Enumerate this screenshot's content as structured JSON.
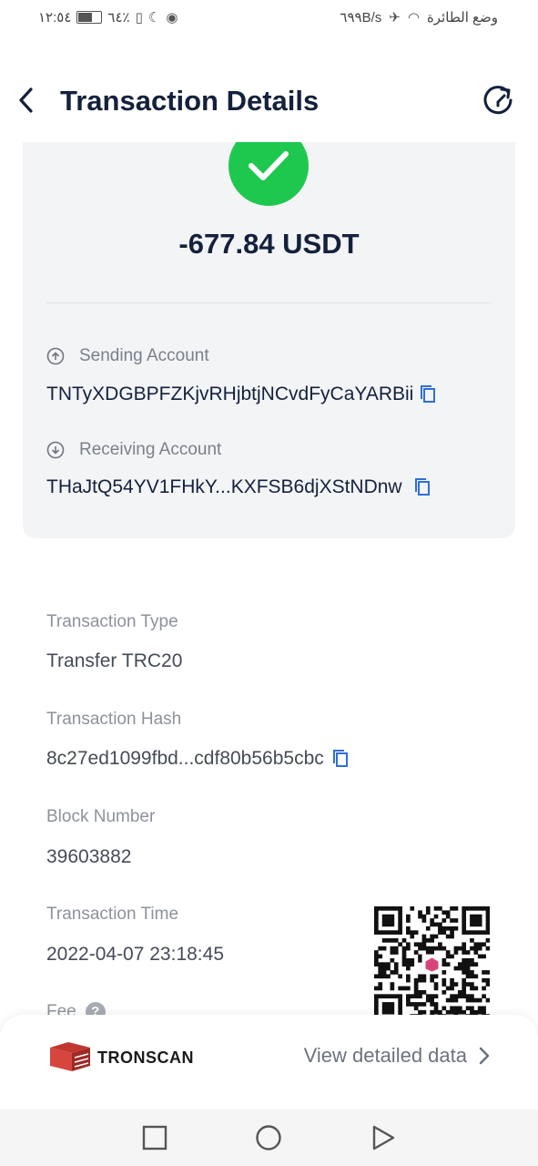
{
  "status_bar": {
    "time": "١٢:٥٤",
    "battery": "٦٤٪",
    "speed": "٦٩٩B/s",
    "airplane_mode": "وضع الطائرة"
  },
  "header": {
    "title": "Transaction Details"
  },
  "summary": {
    "amount": "-677.84 USDT",
    "sending_label": "Sending Account",
    "sending_address": "TNTyXDGBPFZKjvRHjbtjNCvdFyCaYARBii",
    "receiving_label": "Receiving Account",
    "receiving_address": "THaJtQ54YV1FHkY...KXFSB6djXStNDnw"
  },
  "details": {
    "type_label": "Transaction Type",
    "type_value": "Transfer TRC20",
    "hash_label": "Transaction Hash",
    "hash_value": "8c27ed1099fbd...cdf80b56b5cbc",
    "block_label": "Block Number",
    "block_value": "39603882",
    "time_label": "Transaction Time",
    "time_value": "2022-04-07 23:18:45",
    "fee_label": "Fee"
  },
  "footer": {
    "brand": "TRONSCAN",
    "view_link": "View detailed data"
  },
  "colors": {
    "success": "#1ec84f",
    "copy_icon": "#2f6fd6",
    "title": "#14213d",
    "tronscan_red": "#c23631"
  },
  "icons": [
    "back-arrow-icon",
    "refresh-icon",
    "check-icon",
    "arrow-up-circle-icon",
    "arrow-down-circle-icon",
    "copy-icon",
    "help-icon",
    "tronscan-logo-icon",
    "chevron-right-icon",
    "qr-code",
    "nav-square-icon",
    "nav-circle-icon",
    "nav-triangle-icon"
  ]
}
